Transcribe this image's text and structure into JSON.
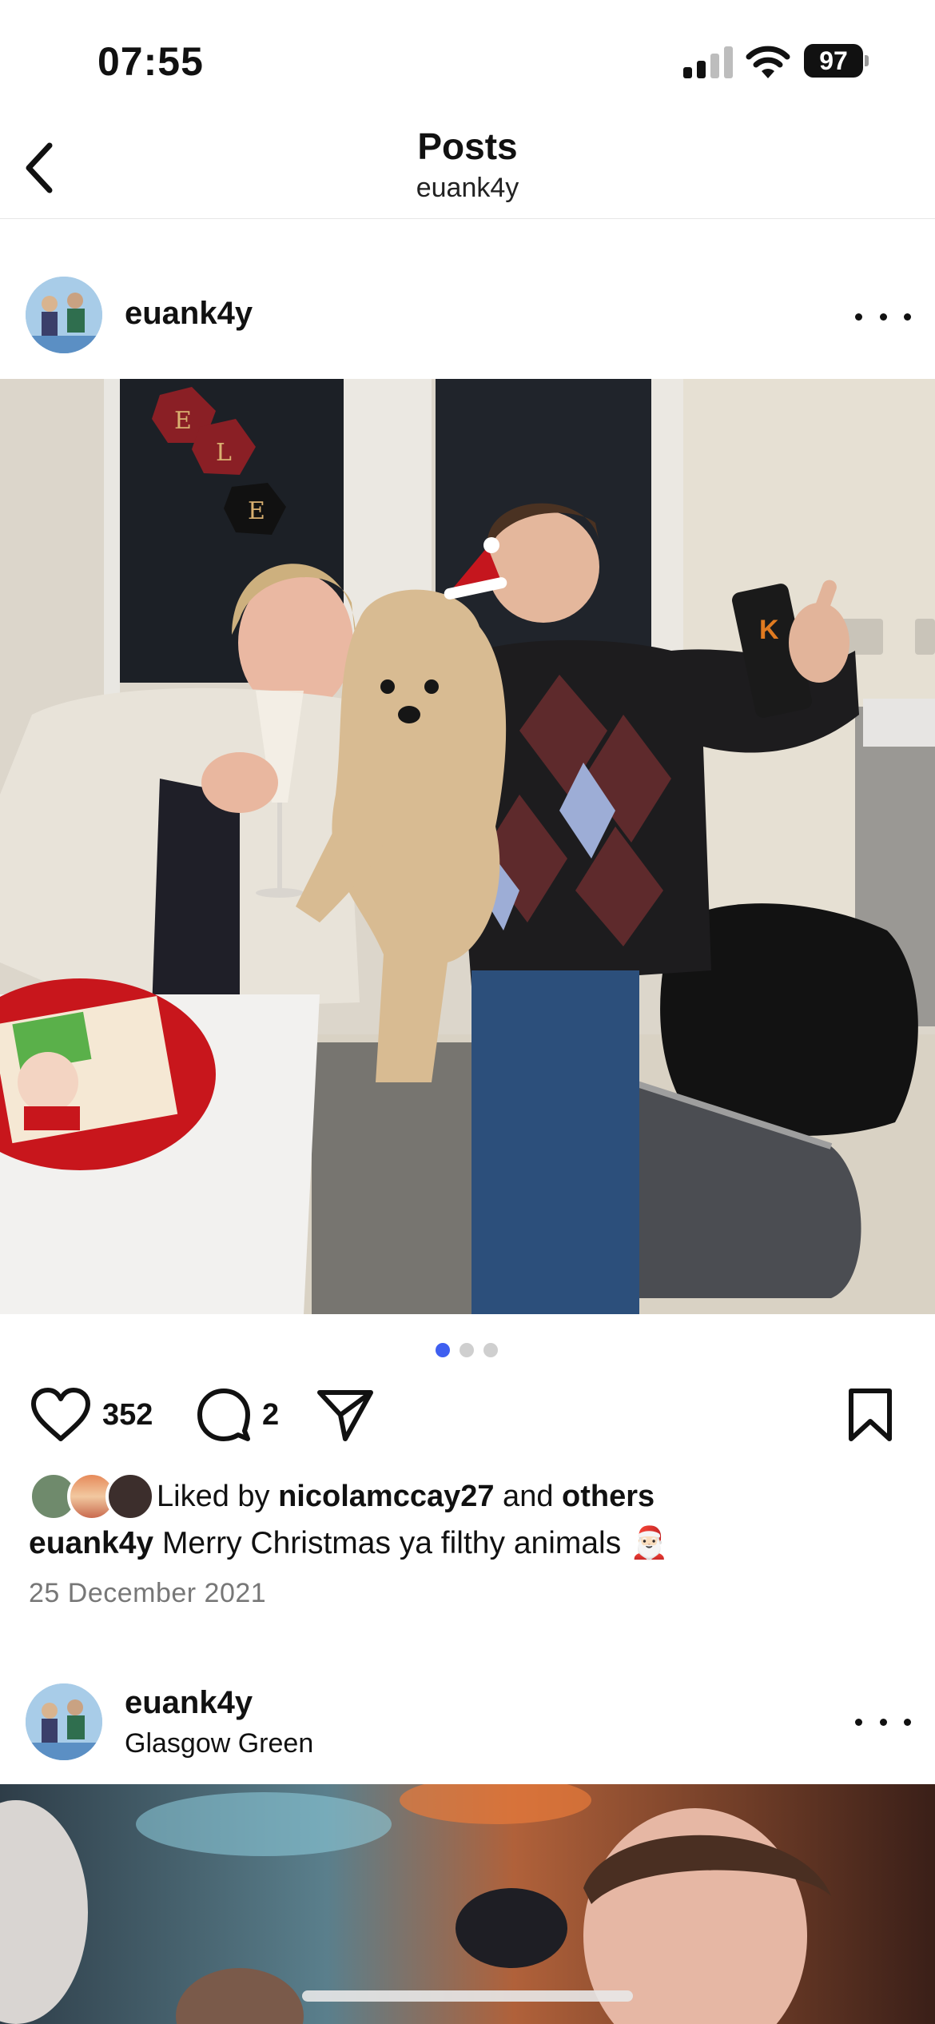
{
  "status_bar": {
    "time": "07:55",
    "battery": "97"
  },
  "nav": {
    "title": "Posts",
    "subtitle": "euank4y"
  },
  "post1": {
    "username": "euank4y",
    "likes": "352",
    "comments": "2",
    "liked_prefix": "Liked by ",
    "liked_user": "nicolamccay27",
    "liked_and": " and ",
    "liked_others": "others",
    "caption_user": "euank4y",
    "caption_text": " Merry Christmas ya filthy animals 🎅🏻",
    "date": "25 December 2021",
    "carousel": {
      "count": 3,
      "active": 1
    },
    "photo_lettering": [
      "E",
      "L",
      "E"
    ],
    "can_lettering": "K"
  },
  "post2": {
    "username": "euank4y",
    "location": "Glasgow Green"
  },
  "colors": {
    "accent_dot": "#3f5ff0",
    "text": "#111111",
    "muted": "#777777"
  },
  "icons": [
    "back-chevron-icon",
    "more-icon",
    "heart-icon",
    "comment-icon",
    "share-icon",
    "bookmark-icon",
    "cellular-signal-icon",
    "wifi-icon",
    "battery-icon"
  ]
}
